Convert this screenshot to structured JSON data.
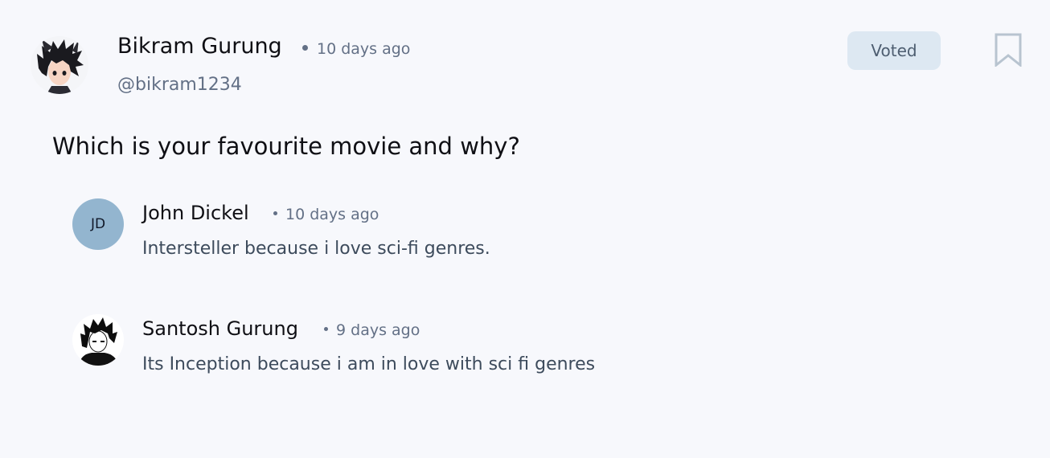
{
  "post": {
    "author": {
      "name": "Bikram Gurung",
      "handle": "@bikram1234",
      "avatar_icon": "anime-boy-avatar"
    },
    "time": "10 days ago",
    "voted_label": "Voted",
    "question": "Which is your favourite movie and why?"
  },
  "comments": [
    {
      "initials": "JD",
      "name": "John Dickel",
      "time": "10 days ago",
      "text": "Intersteller because i love sci-fi genres.",
      "avatar_color": "#93b5cf"
    },
    {
      "name": "Santosh Gurung",
      "time": "9 days ago",
      "text": "Its Inception because i am in love with sci fi genres",
      "avatar_icon": "anime-character-avatar"
    }
  ],
  "colors": {
    "background": "#f7f8fc",
    "muted_text": "#637086",
    "voted_bg": "#dde8f2",
    "bookmark": "#b8c4d0"
  },
  "icons": {
    "bookmark": "bookmark-icon"
  }
}
